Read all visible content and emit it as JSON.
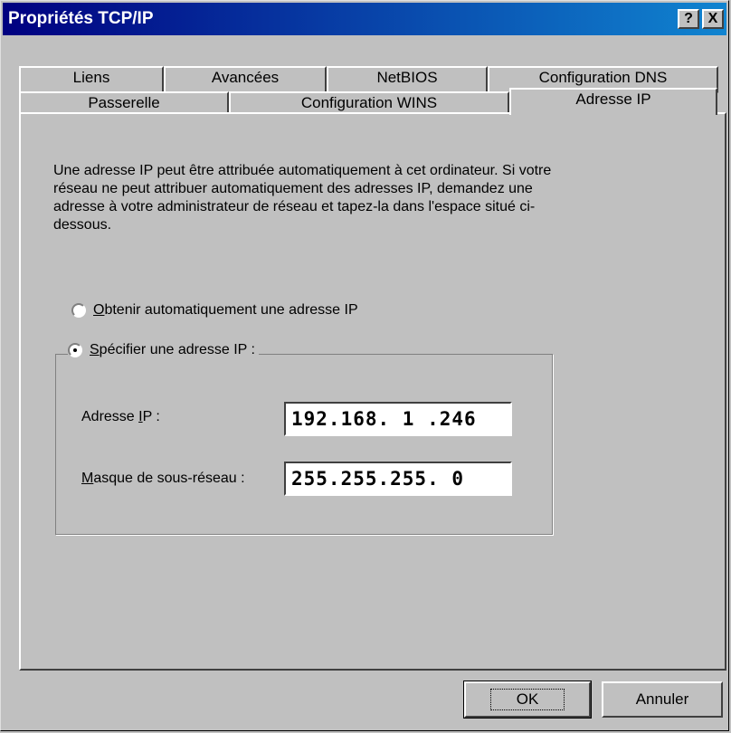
{
  "window": {
    "title": "Propriétés TCP/IP",
    "help_button": "?",
    "close_button": "X"
  },
  "tabs_row1": [
    "Liens",
    "Avancées",
    "NetBIOS",
    "Configuration DNS"
  ],
  "tabs_row2": [
    "Passerelle",
    "Configuration WINS",
    "Adresse IP"
  ],
  "active_tab": "Adresse IP",
  "intro_text": "Une adresse IP peut être attribuée automatiquement à cet ordinateur. Si votre réseau ne peut attribuer automatiquement des adresses IP, demandez une adresse à votre administrateur de réseau et tapez-la dans l'espace situé ci-dessous.",
  "radio_auto": {
    "label_first": "O",
    "label_rest": "btenir automatiquement une adresse IP",
    "checked": false
  },
  "radio_manual": {
    "label_first": "S",
    "label_rest": "pécifier une adresse IP :",
    "checked": true
  },
  "ip_field": {
    "label_pre": "Adresse ",
    "label_ul": "I",
    "label_post": "P :",
    "value": "192.168. 1 .246"
  },
  "mask_field": {
    "label_ul": "M",
    "label_post": "asque de sous-réseau :",
    "value": "255.255.255. 0"
  },
  "buttons": {
    "ok": "OK",
    "cancel": "Annuler"
  }
}
